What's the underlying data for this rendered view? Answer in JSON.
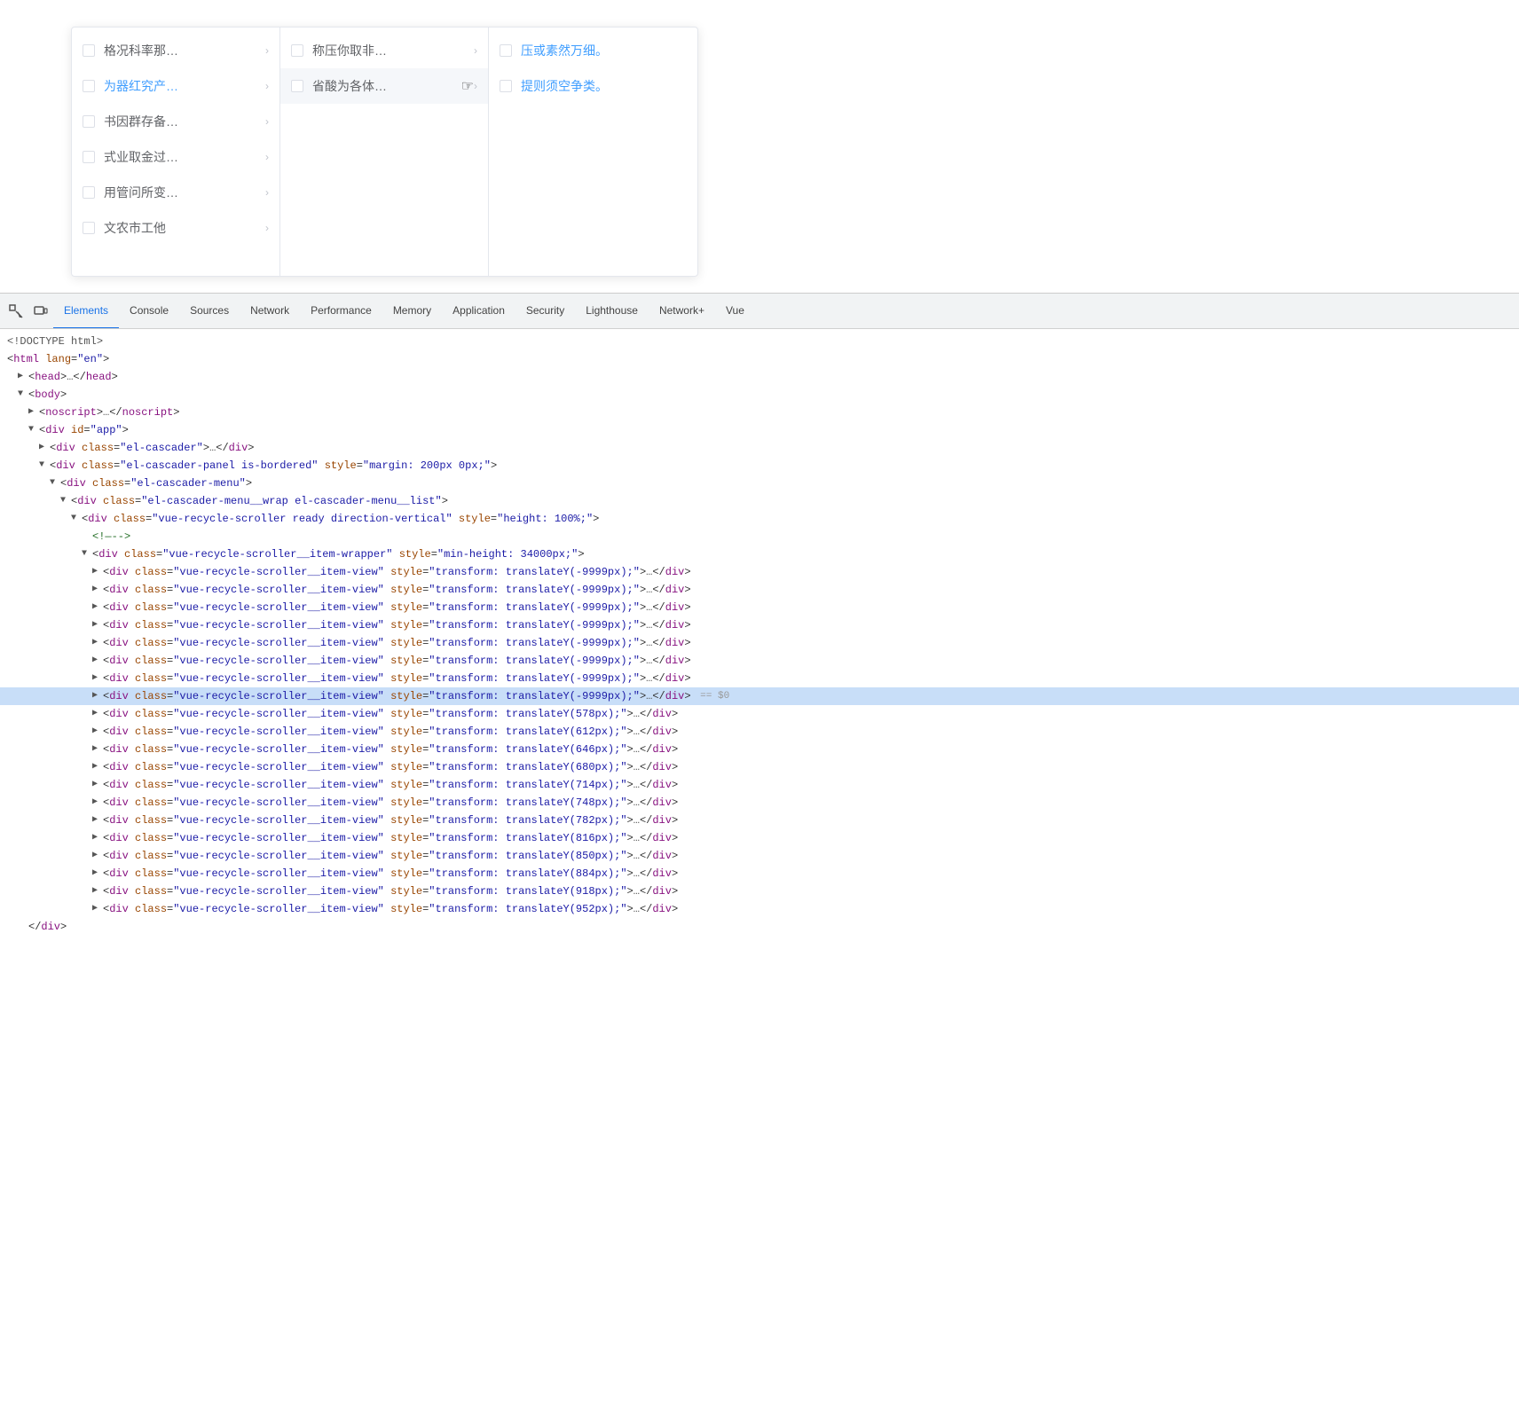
{
  "cascader": {
    "columns": [
      {
        "items": [
          {
            "id": "c1-1",
            "label": "格况科率那…",
            "hasArrow": true,
            "checked": false,
            "isLink": false
          },
          {
            "id": "c1-2",
            "label": "为器红究产…",
            "hasArrow": true,
            "checked": false,
            "isLink": true
          },
          {
            "id": "c1-3",
            "label": "书因群存备…",
            "hasArrow": true,
            "checked": false,
            "isLink": false
          },
          {
            "id": "c1-4",
            "label": "式业取金过…",
            "hasArrow": true,
            "checked": false,
            "isLink": false
          },
          {
            "id": "c1-5",
            "label": "用管问所变…",
            "hasArrow": true,
            "checked": false,
            "isLink": false
          },
          {
            "id": "c1-6",
            "label": "文农市工他",
            "hasArrow": true,
            "checked": false,
            "isLink": false
          }
        ]
      },
      {
        "items": [
          {
            "id": "c2-1",
            "label": "称压你取非…",
            "hasArrow": true,
            "checked": false,
            "isLink": false
          },
          {
            "id": "c2-2",
            "label": "省酸为各体…",
            "hasArrow": true,
            "checked": false,
            "isLink": false,
            "hovered": true
          }
        ]
      },
      {
        "items": [
          {
            "id": "c3-1",
            "label": "压或素然万细。",
            "hasArrow": false,
            "checked": false,
            "isLink": true
          },
          {
            "id": "c3-2",
            "label": "提则须空争类。",
            "hasArrow": false,
            "checked": false,
            "isLink": true
          }
        ]
      }
    ]
  },
  "devtools": {
    "tabs": [
      {
        "id": "elements",
        "label": "Elements",
        "active": true
      },
      {
        "id": "console",
        "label": "Console",
        "active": false
      },
      {
        "id": "sources",
        "label": "Sources",
        "active": false
      },
      {
        "id": "network",
        "label": "Network",
        "active": false
      },
      {
        "id": "performance",
        "label": "Performance",
        "active": false
      },
      {
        "id": "memory",
        "label": "Memory",
        "active": false
      },
      {
        "id": "application",
        "label": "Application",
        "active": false
      },
      {
        "id": "security",
        "label": "Security",
        "active": false
      },
      {
        "id": "lighthouse",
        "label": "Lighthouse",
        "active": false
      },
      {
        "id": "network-plus",
        "label": "Network+",
        "active": false
      },
      {
        "id": "vue",
        "label": "Vue",
        "active": false
      }
    ],
    "code_lines": [
      {
        "id": "l1",
        "indent": 0,
        "expand": "",
        "content": "<!DOCTYPE html>",
        "selected": false
      },
      {
        "id": "l2",
        "indent": 0,
        "expand": "",
        "content": "<html lang=\"en\">",
        "selected": false
      },
      {
        "id": "l3",
        "indent": 1,
        "expand": "collapsed",
        "content": "<head>…</head>",
        "selected": false
      },
      {
        "id": "l4",
        "indent": 1,
        "expand": "expanded",
        "content": "<body>",
        "selected": false
      },
      {
        "id": "l5",
        "indent": 2,
        "expand": "collapsed",
        "content": "<noscript>…</noscript>",
        "selected": false
      },
      {
        "id": "l6",
        "indent": 2,
        "expand": "expanded",
        "content": "<div id=\"app\">",
        "selected": false
      },
      {
        "id": "l7",
        "indent": 3,
        "expand": "collapsed",
        "content": "<div class=\"el-cascader\">…</div>",
        "selected": false
      },
      {
        "id": "l8",
        "indent": 3,
        "expand": "expanded",
        "content": "<div class=\"el-cascader-panel is-bordered\" style=\"margin: 200px 0px;\">",
        "selected": false
      },
      {
        "id": "l9",
        "indent": 4,
        "expand": "expanded",
        "content": "<div class=\"el-cascader-menu\">",
        "selected": false
      },
      {
        "id": "l10",
        "indent": 5,
        "expand": "expanded",
        "content": "<div class=\"el-cascader-menu__wrap el-cascader-menu__list\">",
        "selected": false
      },
      {
        "id": "l11",
        "indent": 6,
        "expand": "expanded",
        "content": "<div class=\"vue-recycle-scroller ready direction-vertical\" style=\"height: 100%;\">",
        "selected": false
      },
      {
        "id": "l12",
        "indent": 7,
        "expand": "leaf",
        "content": "<!—-->",
        "selected": false,
        "isComment": true
      },
      {
        "id": "l13",
        "indent": 7,
        "expand": "expanded",
        "content": "<div class=\"vue-recycle-scroller__item-wrapper\" style=\"min-height: 34000px;\">",
        "selected": false
      },
      {
        "id": "l14",
        "indent": 8,
        "expand": "collapsed",
        "content": "<div class=\"vue-recycle-scroller__item-view\" style=\"transform: translateY(-9999px);\">…</div>",
        "selected": false
      },
      {
        "id": "l15",
        "indent": 8,
        "expand": "collapsed",
        "content": "<div class=\"vue-recycle-scroller__item-view\" style=\"transform: translateY(-9999px);\">…</div>",
        "selected": false
      },
      {
        "id": "l16",
        "indent": 8,
        "expand": "collapsed",
        "content": "<div class=\"vue-recycle-scroller__item-view\" style=\"transform: translateY(-9999px);\">…</div>",
        "selected": false
      },
      {
        "id": "l17",
        "indent": 8,
        "expand": "collapsed",
        "content": "<div class=\"vue-recycle-scroller__item-view\" style=\"transform: translateY(-9999px);\">…</div>",
        "selected": false
      },
      {
        "id": "l18",
        "indent": 8,
        "expand": "collapsed",
        "content": "<div class=\"vue-recycle-scroller__item-view\" style=\"transform: translateY(-9999px);\">…</div>",
        "selected": false
      },
      {
        "id": "l19",
        "indent": 8,
        "expand": "collapsed",
        "content": "<div class=\"vue-recycle-scroller__item-view\" style=\"transform: translateY(-9999px);\">…</div>",
        "selected": false
      },
      {
        "id": "l20",
        "indent": 8,
        "expand": "collapsed",
        "content": "<div class=\"vue-recycle-scroller__item-view\" style=\"transform: translateY(-9999px);\">…</div>",
        "selected": false
      },
      {
        "id": "l21",
        "indent": 8,
        "expand": "collapsed",
        "content": "<div class=\"vue-recycle-scroller__item-view\" style=\"transform: translateY(-9999px);\">…</div>",
        "selected": false,
        "domSelected": true,
        "selectedMarker": "== $0"
      },
      {
        "id": "l22",
        "indent": 8,
        "expand": "collapsed",
        "content": "<div class=\"vue-recycle-scroller__item-view\" style=\"transform: translateY(578px);\">…</div>",
        "selected": false
      },
      {
        "id": "l23",
        "indent": 8,
        "expand": "collapsed",
        "content": "<div class=\"vue-recycle-scroller__item-view\" style=\"transform: translateY(612px);\">…</div>",
        "selected": false
      },
      {
        "id": "l24",
        "indent": 8,
        "expand": "collapsed",
        "content": "<div class=\"vue-recycle-scroller__item-view\" style=\"transform: translateY(646px);\">…</div>",
        "selected": false
      },
      {
        "id": "l25",
        "indent": 8,
        "expand": "collapsed",
        "content": "<div class=\"vue-recycle-scroller__item-view\" style=\"transform: translateY(680px);\">…</div>",
        "selected": false
      },
      {
        "id": "l26",
        "indent": 8,
        "expand": "collapsed",
        "content": "<div class=\"vue-recycle-scroller__item-view\" style=\"transform: translateY(714px);\">…</div>",
        "selected": false
      },
      {
        "id": "l27",
        "indent": 8,
        "expand": "collapsed",
        "content": "<div class=\"vue-recycle-scroller__item-view\" style=\"transform: translateY(748px);\">…</div>",
        "selected": false
      },
      {
        "id": "l28",
        "indent": 8,
        "expand": "collapsed",
        "content": "<div class=\"vue-recycle-scroller__item-view\" style=\"transform: translateY(782px);\">…</div>",
        "selected": false
      },
      {
        "id": "l29",
        "indent": 8,
        "expand": "collapsed",
        "content": "<div class=\"vue-recycle-scroller__item-view\" style=\"transform: translateY(816px);\">…</div>",
        "selected": false
      },
      {
        "id": "l30",
        "indent": 8,
        "expand": "collapsed",
        "content": "<div class=\"vue-recycle-scroller__item-view\" style=\"transform: translateY(850px);\">…</div>",
        "selected": false
      },
      {
        "id": "l31",
        "indent": 8,
        "expand": "collapsed",
        "content": "<div class=\"vue-recycle-scroller__item-view\" style=\"transform: translateY(884px);\">…</div>",
        "selected": false
      },
      {
        "id": "l32",
        "indent": 8,
        "expand": "collapsed",
        "content": "<div class=\"vue-recycle-scroller__item-view\" style=\"transform: translateY(918px);\">…</div>",
        "selected": false
      },
      {
        "id": "l33",
        "indent": 8,
        "expand": "collapsed",
        "content": "<div class=\"vue-recycle-scroller__item-view\" style=\"transform: translateY(952px);\">…</div>",
        "selected": false
      },
      {
        "id": "l34",
        "indent": 1,
        "expand": "leaf",
        "content": "</div>",
        "selected": false
      }
    ]
  }
}
